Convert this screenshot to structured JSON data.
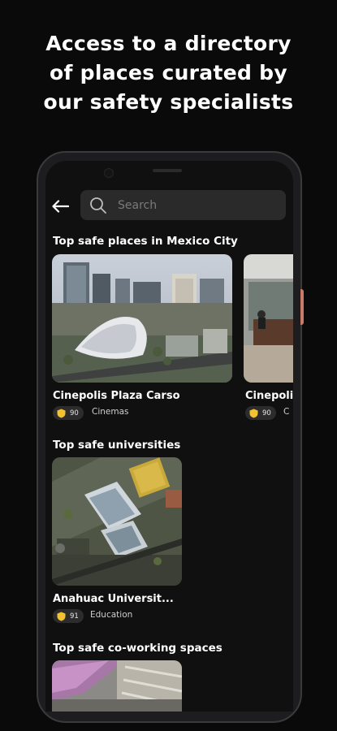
{
  "headline": {
    "line1": "Access to a directory",
    "line2": "of places curated by",
    "line3": "our safety specialists"
  },
  "search": {
    "placeholder": "Search"
  },
  "sections": [
    {
      "title": "Top safe places in Mexico City",
      "cards": [
        {
          "name": "Cinepolis Plaza Carso",
          "score": "90",
          "category": "Cinemas"
        },
        {
          "name": "Cinepolis",
          "score": "90",
          "category": "C"
        }
      ]
    },
    {
      "title": "Top safe universities",
      "cards": [
        {
          "name": "Anahuac Universit...",
          "score": "91",
          "category": "Education"
        }
      ]
    },
    {
      "title": "Top safe co-working spaces",
      "cards": []
    }
  ],
  "colors": {
    "background": "#0a0a0a",
    "badge_accent": "#f2c230"
  }
}
